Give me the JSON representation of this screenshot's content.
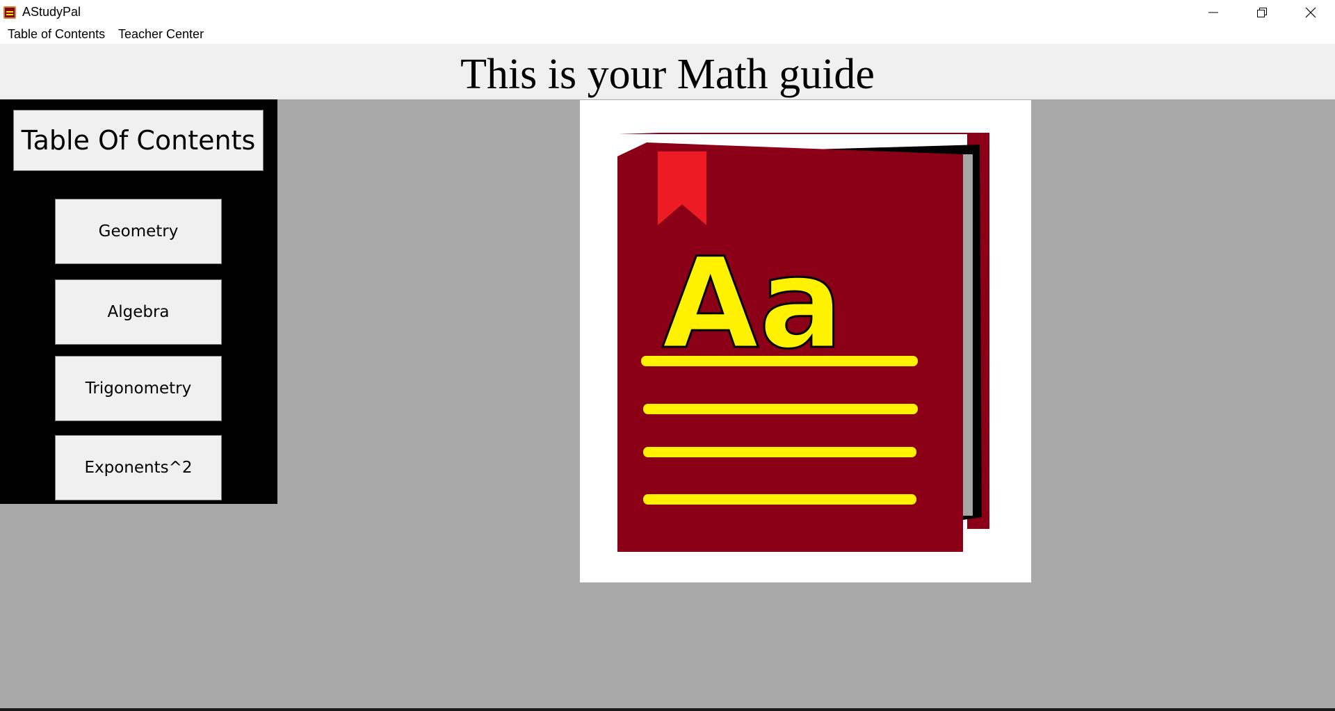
{
  "window": {
    "title": "AStudyPal",
    "icon": "app-book-icon",
    "controls": [
      "minimize-icon",
      "restore-icon",
      "close-icon"
    ]
  },
  "menubar": {
    "items": [
      "Table of Contents",
      "Teacher Center"
    ]
  },
  "header": {
    "title": "This is your Math guide"
  },
  "toc": {
    "title": "Table Of Contents",
    "buttons": [
      "Geometry",
      "Algebra",
      "Trigonometry",
      "Exponents^2"
    ]
  },
  "illustration": {
    "icon": "dictionary-book-icon",
    "text": "Aa",
    "colors": {
      "cover": "#8b0016",
      "bookmark": "#ed1c24",
      "accent": "#fff200"
    }
  },
  "colors": {
    "background": "#a9a9a9",
    "sidebar": "#000000",
    "button": "#f0f0f0",
    "header": "#f0f0f0"
  }
}
